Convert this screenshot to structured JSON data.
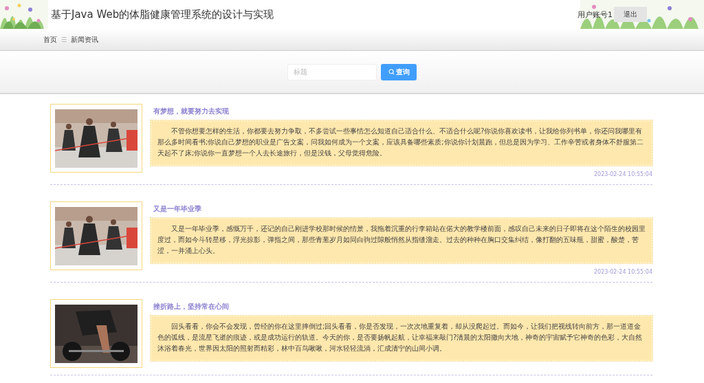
{
  "header": {
    "title": "基于Java Web的体脂健康管理系统的设计与实现",
    "user": "用户账号1",
    "logout": "退出"
  },
  "breadcrumb": [
    {
      "label": "首页"
    },
    {
      "label": "新闻资讯"
    }
  ],
  "breadcrumb_separator": "☰",
  "search": {
    "placeholder": "标题",
    "button": "查询"
  },
  "news": [
    {
      "title": "有梦想，就要努力去实现",
      "summary": "不管你想要怎样的生活，你都要去努力争取，不多尝试一些事情怎么知道自己适合什么、不适合什么呢?你说你喜欢读书，让我给你列书单，你还问我哪里有那么多时间看书;你说自己梦想的职业是广告文案，问我如何成为一个文案，应该具备哪些素质;你说你计划晨跑，但总是因为学习、工作辛苦或者身体不舒服第二天起不了床;你说你一直梦想一个人去长途旅行，但是没钱，父母觉得危险。",
      "time": "2023-02-24 10:55:04"
    },
    {
      "title": "又是一年毕业季",
      "summary": "又是一年毕业季，感慨万千，还记的自己刚进学校那时候的情景，我拖着沉重的行李箱站在偌大的教学楼前面，感叹自己未来的日子即将在这个陌生的校园里度过，而如今斗转星移，浮光掠影，弹指之间，那些青葱岁月如同白驹过隙般悄然从指缝溜走。过去的种种在胸口交集纠结，像打翻的五味瓶，甜蜜，酸楚，苦涩，一并涌上心头。",
      "time": "2023-02-24 10:55:04"
    },
    {
      "title": "挫折路上，坚持常在心间",
      "summary": "回头看看，你会不会发现，曾经的你在这里摔倒过;回头看看，你是否发现，一次次地重复着，却从没爬起过。而如今，让我们把视线转向前方，那一道道金色的弧线，是流星飞逝的痕迹，或是成功运行的轨道。今天的你，是否要扬帆起航，让幸福来敲门?清晨的太阳撒向大地，神奇的宇宙赋予它神奇的色彩，大自然沐浴着春光，世界因太阳的照射而精彩，林中百鸟啾啾，河水轻轻流淌，汇成清宁的山间小调。"
    }
  ]
}
